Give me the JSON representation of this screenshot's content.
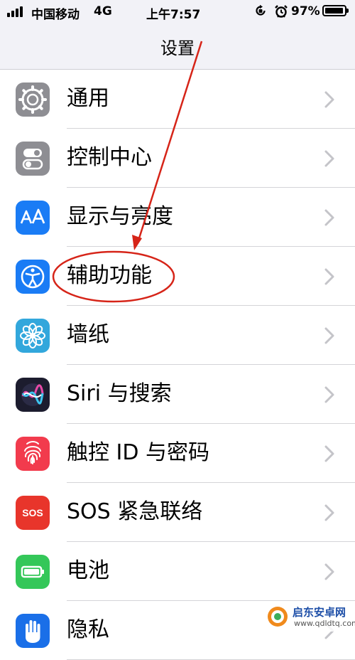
{
  "status_bar": {
    "carrier": "中国移动",
    "network": "4G",
    "time": "上午7:57",
    "battery": "97%",
    "battery_level": 0.97
  },
  "nav": {
    "title": "设置"
  },
  "settings": [
    {
      "label": "通用",
      "icon": "gear-icon",
      "color": "#8e8e93"
    },
    {
      "label": "控制中心",
      "icon": "toggles-icon",
      "color": "#8e8e93"
    },
    {
      "label": "显示与亮度",
      "icon": "text-size-icon",
      "color": "#1a7cf5"
    },
    {
      "label": "辅助功能",
      "icon": "accessibility-icon",
      "color": "#1a7cf5"
    },
    {
      "label": "墙纸",
      "icon": "flower-icon",
      "color": "#32a7dc"
    },
    {
      "label": "Siri 与搜索",
      "icon": "siri-icon",
      "color": "#1c1c2e"
    },
    {
      "label": "触控 ID 与密码",
      "icon": "fingerprint-icon",
      "color": "#f23b4d"
    },
    {
      "label": "SOS 紧急联络",
      "icon": "sos-icon",
      "color": "#e8352b"
    },
    {
      "label": "电池",
      "icon": "battery-icon",
      "color": "#34c759"
    },
    {
      "label": "隐私",
      "icon": "hand-icon",
      "color": "#1a6fe8"
    }
  ],
  "sos_icon_text": "SOS",
  "annotation": {
    "color": "#d62418"
  },
  "watermark": {
    "title": "启东安卓网",
    "url": "www.qdldtq.com"
  }
}
